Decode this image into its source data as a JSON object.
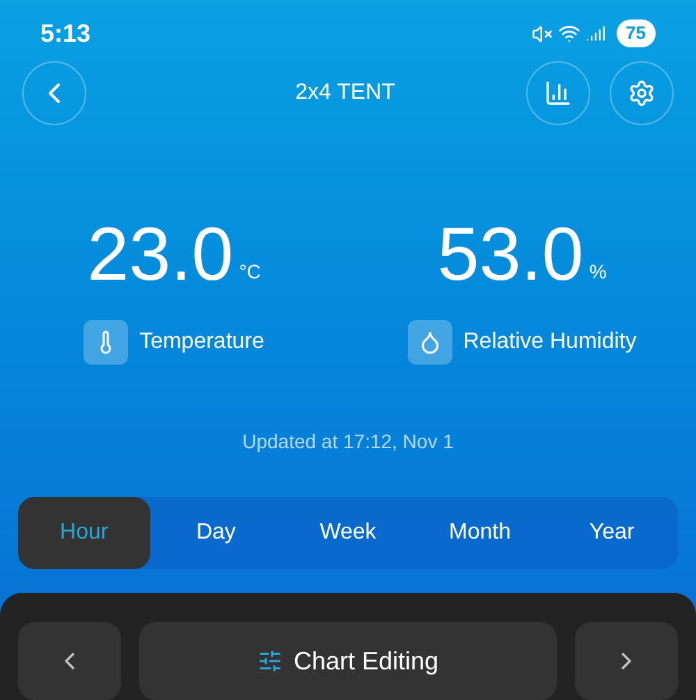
{
  "status_bar": {
    "time": "5:13",
    "battery": "75"
  },
  "header": {
    "title": "2x4 TENT"
  },
  "readings": [
    {
      "kind": "temperature",
      "value": "23.0",
      "unit": "°C",
      "label": "Temperature"
    },
    {
      "kind": "humidity",
      "value": "53.0",
      "unit": "%",
      "label": "Relative Humidity"
    }
  ],
  "updated": "Updated at 17:12, Nov 1",
  "tabs": [
    {
      "label": "Hour",
      "selected": true
    },
    {
      "label": "Day",
      "selected": false
    },
    {
      "label": "Week",
      "selected": false
    },
    {
      "label": "Month",
      "selected": false
    },
    {
      "label": "Year",
      "selected": false
    }
  ],
  "bottom": {
    "chart_editing": "Chart Editing"
  }
}
